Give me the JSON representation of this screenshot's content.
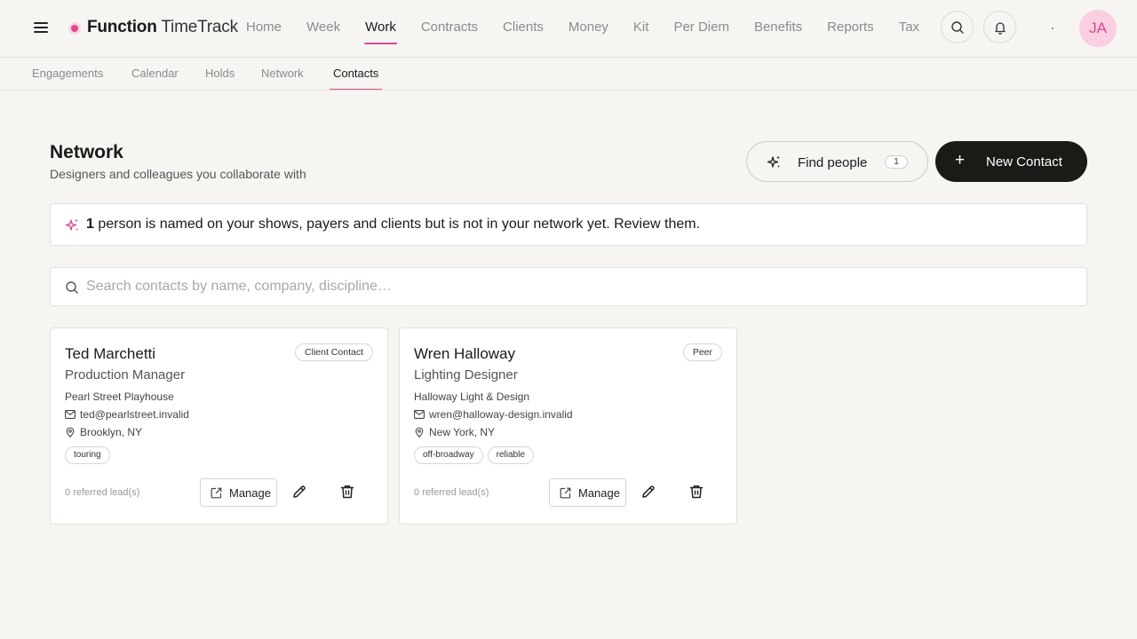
{
  "brand": {
    "name_bold": "Function",
    "name_light": "TimeTrack"
  },
  "main_nav": [
    "Home",
    "Week",
    "Work",
    "Contracts",
    "Clients",
    "Money",
    "Kit",
    "Per Diem",
    "Benefits",
    "Reports",
    "Tax"
  ],
  "main_nav_active": "Work",
  "user": {
    "initials": "JA"
  },
  "sub_nav": [
    "Engagements",
    "Calendar",
    "Holds",
    "Network",
    "Contacts"
  ],
  "sub_nav_active": "Contacts",
  "header": {
    "title": "Network",
    "subtitle": "Designers and colleagues you collaborate with",
    "find_people_label": "Find people",
    "find_people_count": "1",
    "new_contact_label": "New Contact"
  },
  "banner": {
    "count": "1",
    "text": " person is named on your shows, payers and clients but is not in your network yet. Review them."
  },
  "search": {
    "placeholder": "Search contacts by name, company, discipline…",
    "value": ""
  },
  "contacts": [
    {
      "name": "Ted Marchetti",
      "role": "Production Manager",
      "badge": "Client Contact",
      "company": "Pearl Street Playhouse",
      "email": "ted@pearlstreet.invalid",
      "location": "Brooklyn, NY",
      "tags": [
        "touring"
      ],
      "leads": "0 referred lead(s)",
      "manage_label": "Manage"
    },
    {
      "name": "Wren Halloway",
      "role": "Lighting Designer",
      "badge": "Peer",
      "company": "Halloway Light & Design",
      "email": "wren@halloway-design.invalid",
      "location": "New York, NY",
      "tags": [
        "off-broadway",
        "reliable"
      ],
      "leads": "0 referred lead(s)",
      "manage_label": "Manage"
    }
  ],
  "colors": {
    "accent": "#d64a92",
    "avatar_bg": "#f9cfe1",
    "primary_button": "#1b1a17",
    "background": "#f6f5f2"
  }
}
